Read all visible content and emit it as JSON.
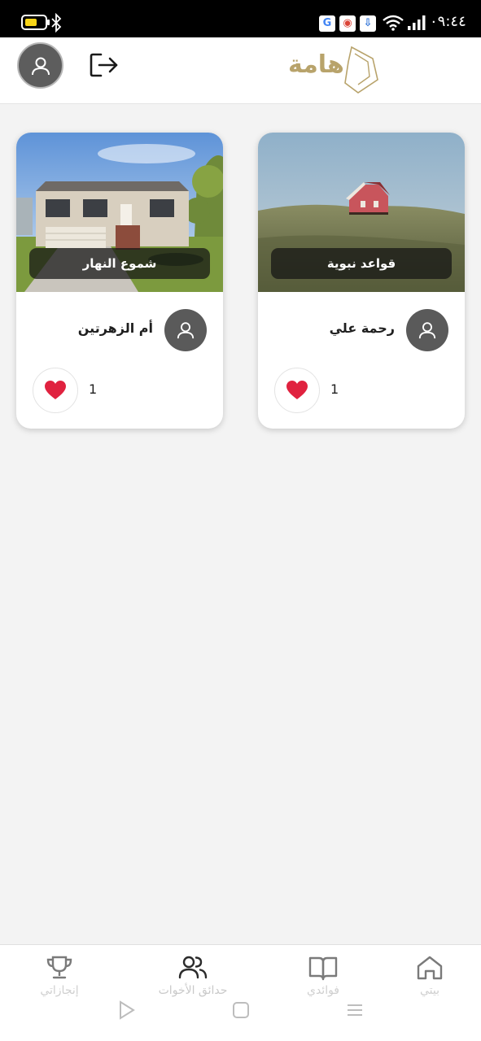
{
  "status_bar": {
    "time": "٠٩:٤٤",
    "battery_color": "#f7d417",
    "notification_icons": [
      "google-icon",
      "chrome-icon",
      "download-icon"
    ]
  },
  "header": {
    "logo_text": "هامة",
    "icons": [
      "profile-avatar-icon",
      "logout-icon"
    ]
  },
  "cards": [
    {
      "title": "قواعد نبوية",
      "author": "رحمة علي",
      "likes": "1",
      "image": "red-cabin-on-hill"
    },
    {
      "title": "شموع النهار",
      "author": "أم الزهرتين",
      "likes": "1",
      "image": "suburban-house"
    }
  ],
  "bottom_nav": {
    "items": [
      {
        "label": "بيتي",
        "icon": "home-icon"
      },
      {
        "label": "فوائدي",
        "icon": "book-icon"
      },
      {
        "label": "حدائق الأخوات",
        "icon": "users-icon"
      },
      {
        "label": "إنجازاتي",
        "icon": "trophy-icon"
      }
    ]
  },
  "colors": {
    "heart": "#e0223f",
    "logo": "#b8a36b",
    "avatar": "#5d5d5d"
  }
}
